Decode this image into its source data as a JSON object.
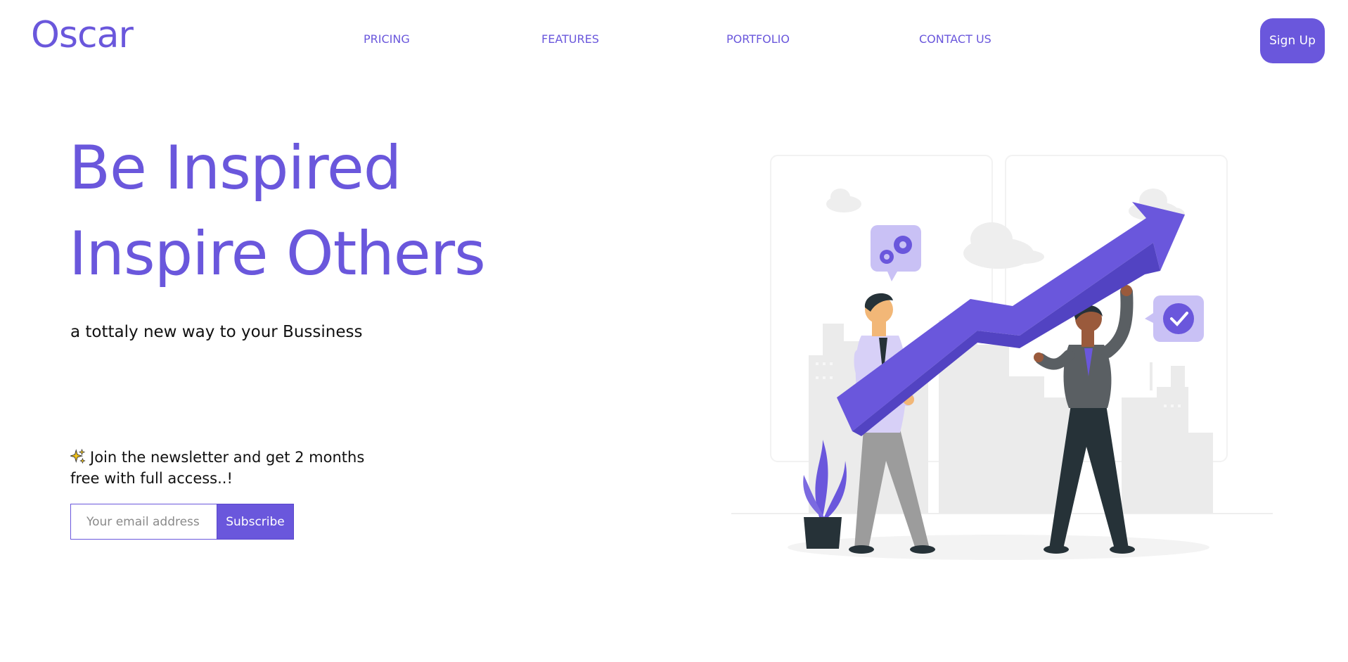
{
  "brand": {
    "logo": "Oscar"
  },
  "nav": {
    "items": [
      {
        "label": "PRICING"
      },
      {
        "label": "FEATURES"
      },
      {
        "label": "PORTFOLIO"
      },
      {
        "label": "CONTACT US"
      }
    ],
    "signup_label": "Sign Up"
  },
  "hero": {
    "title_line1": "Be Inspired",
    "title_line2": "Inspire Others",
    "subtitle": "a tottaly new way to your Bussiness"
  },
  "newsletter": {
    "text": "Join the newsletter and get 2 months free with full access..!",
    "email_placeholder": "Your email address",
    "subscribe_label": "Subscribe"
  },
  "colors": {
    "accent": "#6a57dc",
    "accent_light": "#c9c1f5",
    "city_gray": "#ececec",
    "dark": "#263238"
  },
  "icons": [
    "sparkle-icon",
    "gears-icon",
    "checkmark-icon"
  ]
}
